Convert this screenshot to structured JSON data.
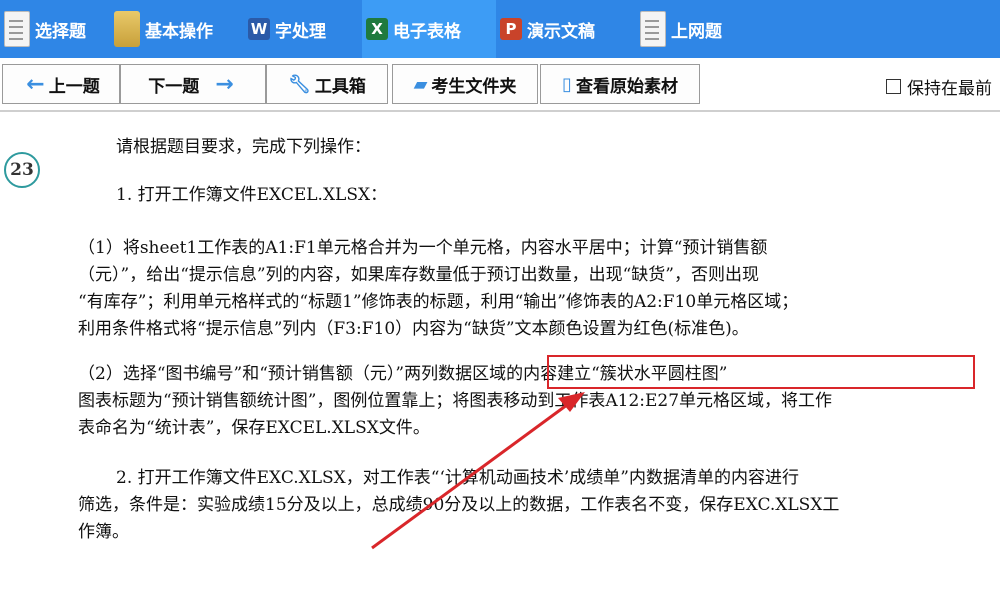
{
  "tabs": [
    {
      "label": "选择题",
      "icon": "document-list-icon"
    },
    {
      "label": "基本操作",
      "icon": "folder-icon"
    },
    {
      "label": "字处理",
      "icon": "word-icon",
      "letter": "W"
    },
    {
      "label": "电子表格",
      "icon": "excel-icon",
      "letter": "X",
      "active": true
    },
    {
      "label": "演示文稿",
      "icon": "powerpoint-icon",
      "letter": "P"
    },
    {
      "label": "上网题",
      "icon": "document-list-icon"
    }
  ],
  "toolbar": {
    "prev_label": "上一题",
    "next_label": "下一题",
    "tools_label": "工具箱",
    "folder_label": "考生文件夹",
    "source_label": "查看原始素材",
    "keep_on_top_label": "保持在最前"
  },
  "question": {
    "number": "23",
    "intro": "请根据题目要求，完成下列操作：",
    "item1_title": "1. 打开工作簿文件EXCEL.XLSX：",
    "item1_sub1_lines": [
      "（1）将sheet1工作表的A1:F1单元格合并为一个单元格，内容水平居中；计算“预计销售额",
      "（元）”，给出“提示信息”列的内容，如果库存数量低于预订出数量，出现“缺货”，否则出现",
      "“有库存”；利用单元格样式的“标题1”修饰表的标题，利用“输出”修饰表的A2:F10单元格区域；",
      "利用条件格式将“提示信息”列内（F3:F10）内容为“缺货”文本颜色设置为红色(标准色)。"
    ],
    "item1_sub2_lines": [
      "（2）选择“图书编号”和“预计销售额（元）”两列数据区域的内容建立“簇状水平圆柱图”",
      "图表标题为“预计销售额统计图”，图例位置靠上；将图表移动到工作表A12:E27单元格区域，将工作",
      "表命名为“统计表”，保存EXCEL.XLSX文件。"
    ],
    "item2_lines": [
      "2. 打开工作簿文件EXC.XLSX，对工作表“‘计算机动画技术’成绩单”内数据清单的内容进行",
      "筛选，条件是：实验成绩15分及以上，总成绩90分及以上的数据，工作表名不变，保存EXC.XLSX工",
      "作簿。"
    ]
  },
  "colors": {
    "topbar": "#2f86e6",
    "active_tab": "#3d9cf5",
    "highlight": "#d9262a",
    "accent": "#3b8fe0"
  }
}
